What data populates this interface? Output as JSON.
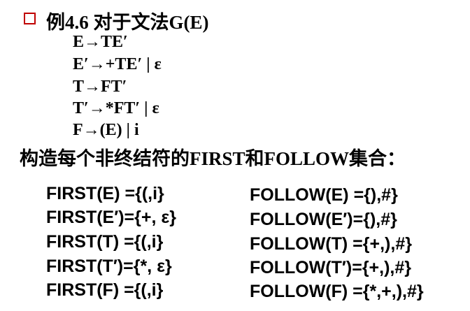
{
  "title": "例4.6  对于文法G(E)",
  "productions": [
    "E→TE′",
    "E′→+TE′ | ε",
    "T→FT′",
    "T′→*FT′ | ε",
    "F→(E) | i"
  ],
  "heading": "构造每个非终结符的FIRST和FOLLOW集合：",
  "first_sets": [
    "FIRST(E) ={(,i}",
    "FIRST(E′)={+, ε}",
    "FIRST(T) ={(,i}",
    "FIRST(T′)={*, ε}",
    "FIRST(F) ={(,i}"
  ],
  "follow_sets": [
    "FOLLOW(E) ={),#}",
    "FOLLOW(E′)={),#}",
    "FOLLOW(T) ={+,),#}",
    "FOLLOW(T′)={+,),#}",
    "FOLLOW(F) ={*,+,),#}"
  ],
  "colors": {
    "bullet": "#c00000",
    "text": "#000000",
    "background": "#ffffff"
  }
}
